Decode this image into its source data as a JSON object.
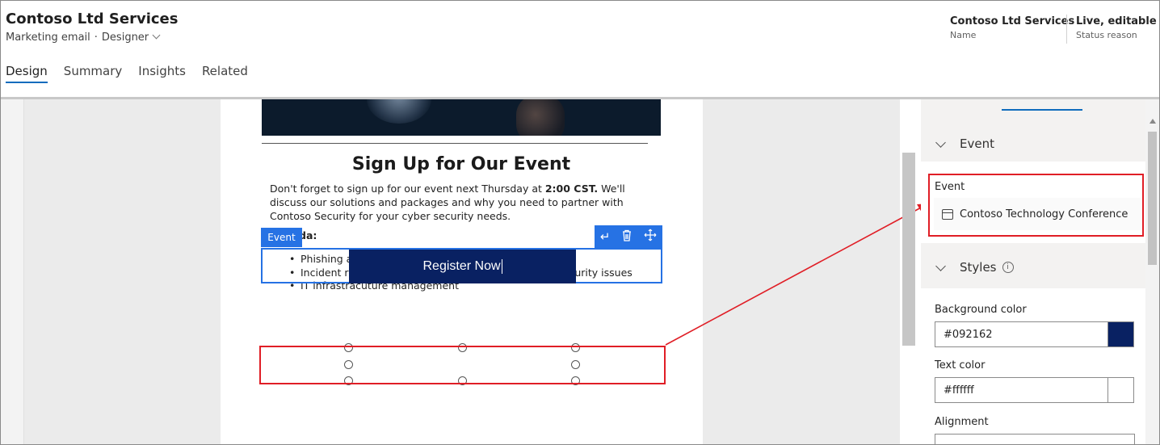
{
  "header": {
    "title": "Contoso Ltd Services",
    "entity": "Marketing email",
    "form": "Designer",
    "fields": [
      {
        "value": "Contoso Ltd Services",
        "label": "Name"
      },
      {
        "value": "Live, editable",
        "label": "Status reason"
      }
    ],
    "tabs": [
      "Design",
      "Summary",
      "Insights",
      "Related"
    ],
    "active_tab": "Design"
  },
  "email": {
    "heading": "Sign Up for Our Event",
    "para_pre": "Don't forget to sign up for our event next Thursday at ",
    "para_bold": "2:00 CST.",
    "para_post": " We'll discuss our solutions and packages and why you need to partner with Contoso Security for your cyber security needs.",
    "agenda_label": "Agenda:",
    "agenda_items": [
      "Phishing assessment and how it protects you data",
      "Incident response so you can quickly get ahead of security issues",
      "IT infrastracuture management"
    ],
    "element_tag": "Event",
    "button_label": "Register Now",
    "toolbar_icons": [
      "return-icon",
      "trash-icon",
      "move-icon"
    ]
  },
  "panel": {
    "event_section": "Event",
    "event_label": "Event",
    "event_value": "Contoso Technology Conference",
    "styles_section": "Styles",
    "bg_label": "Background color",
    "bg_value": "#092162",
    "text_label": "Text color",
    "text_value": "#ffffff",
    "alignment_label": "Alignment"
  },
  "colors": {
    "button_bg": "#092162",
    "highlight": "#e01e26",
    "selection": "#2672e4",
    "accent": "#0f6cbd"
  }
}
